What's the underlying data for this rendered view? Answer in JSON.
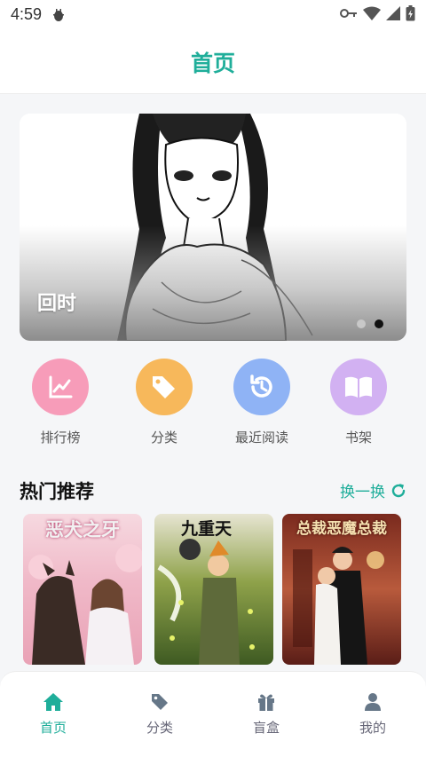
{
  "status_bar": {
    "time": "4:59"
  },
  "header": {
    "title": "首页"
  },
  "banner": {
    "title": "回时",
    "dot_count": 2,
    "active_dot": 2
  },
  "quick_actions": [
    {
      "label": "排行榜",
      "icon": "chart-line-icon",
      "color": "#f79cb9"
    },
    {
      "label": "分类",
      "icon": "tags-icon",
      "color": "#f7b85b"
    },
    {
      "label": "最近阅读",
      "icon": "history-icon",
      "color": "#8fb3f5"
    },
    {
      "label": "书架",
      "icon": "book-open-icon",
      "color": "#d2b1f2"
    }
  ],
  "hot_section": {
    "title": "热门推荐",
    "refresh_label": "换一换"
  },
  "books": [
    {
      "cover_title": "恶犬之牙"
    },
    {
      "cover_title": "九重天"
    },
    {
      "cover_title": "总裁恶魔总裁"
    }
  ],
  "tab_bar": {
    "items": [
      {
        "label": "首页",
        "icon": "home-icon",
        "active": true
      },
      {
        "label": "分类",
        "icon": "tag-icon",
        "active": false
      },
      {
        "label": "盲盒",
        "icon": "gift-icon",
        "active": false
      },
      {
        "label": "我的",
        "icon": "user-icon",
        "active": false
      }
    ]
  },
  "colors": {
    "accent": "#1fae9a",
    "inactive": "#667788"
  }
}
